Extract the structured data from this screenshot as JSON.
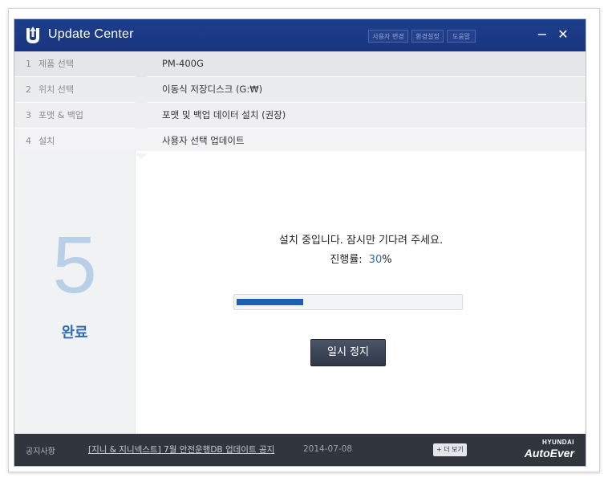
{
  "app": {
    "title": "Update Center"
  },
  "header": {
    "buttons": [
      "사용자 변경",
      "환경설정",
      "도움말"
    ],
    "minimize_label": "−",
    "close_label": "✕"
  },
  "steps": [
    {
      "num": "1",
      "label": "제품 선택",
      "value": "PM-400G"
    },
    {
      "num": "2",
      "label": "위치 선택",
      "value": "이동식 저장디스크 (G:₩)"
    },
    {
      "num": "3",
      "label": "포맷 & 백업",
      "value": "포맷 및 백업 데이터 설치 (권장)"
    },
    {
      "num": "4",
      "label": "설치",
      "value": "사용자 선택 업데이트"
    }
  ],
  "left_panel": {
    "number": "5",
    "label": "완료"
  },
  "main": {
    "message": "설치 중입니다. 잠시만 기다려 주세요.",
    "progress_label": "진행률:",
    "progress_value": "30",
    "progress_unit": "%",
    "progress_fraction": 0.3,
    "pause_label": "일시 정지"
  },
  "footer": {
    "notice_label": "공지사항",
    "notice_text": "[지니 & 지니넥스트] 7월 안전운행DB 업데이트 공지",
    "notice_date": "2014-07-08",
    "more_label": "+ 더 보기",
    "brand_line1": "HYUNDAI",
    "brand_line2": "AutoEver"
  },
  "colors": {
    "titlebar": "#1d3e8a",
    "accent": "#2f6db0",
    "progress_fill": "#1d5fb0",
    "footer": "#30353e"
  }
}
